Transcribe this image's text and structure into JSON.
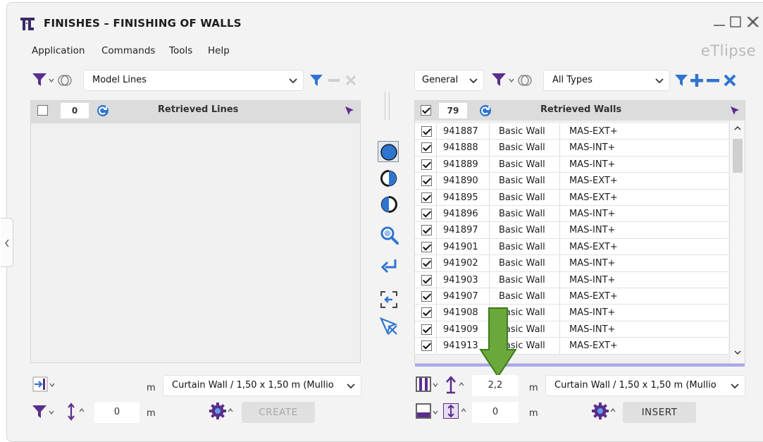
{
  "window": {
    "title": "FINISHES – FINISHING OF WALLS",
    "brand": "eTlipse"
  },
  "menu": [
    "Application",
    "Commands",
    "Tools",
    "Help"
  ],
  "left_panel": {
    "source_combo": "Model Lines",
    "count": "0",
    "header_title": "Retrieved Lines",
    "type_combo": "Curtain Wall / 1,50 x 1,50 m (Mullio",
    "unit_1": "m",
    "offset_value": "0",
    "unit_2": "m",
    "create_label": "CREATE"
  },
  "right_panel": {
    "category_combo": "General",
    "type_filter_combo": "All Types",
    "count": "79",
    "header_title": "Retrieved Walls",
    "rows": [
      {
        "id": "941887",
        "family": "Basic Wall",
        "type": "MAS-EXT+"
      },
      {
        "id": "941888",
        "family": "Basic Wall",
        "type": "MAS-INT+"
      },
      {
        "id": "941889",
        "family": "Basic Wall",
        "type": "MAS-INT+"
      },
      {
        "id": "941890",
        "family": "Basic Wall",
        "type": "MAS-EXT+"
      },
      {
        "id": "941895",
        "family": "Basic Wall",
        "type": "MAS-EXT+"
      },
      {
        "id": "941896",
        "family": "Basic Wall",
        "type": "MAS-INT+"
      },
      {
        "id": "941897",
        "family": "Basic Wall",
        "type": "MAS-INT+"
      },
      {
        "id": "941901",
        "family": "Basic Wall",
        "type": "MAS-EXT+"
      },
      {
        "id": "941902",
        "family": "Basic Wall",
        "type": "MAS-INT+"
      },
      {
        "id": "941903",
        "family": "Basic Wall",
        "type": "MAS-INT+"
      },
      {
        "id": "941907",
        "family": "Basic Wall",
        "type": "MAS-EXT+"
      },
      {
        "id": "941908",
        "family": "Basic Wall",
        "type": "MAS-INT+"
      },
      {
        "id": "941909",
        "family": "Basic Wall",
        "type": "MAS-INT+"
      },
      {
        "id": "941913",
        "family": "Basic Wall",
        "type": "MAS-EXT+"
      }
    ],
    "height_value": "2,2",
    "unit_1": "m",
    "type_combo": "Curtain Wall / 1,50 x 1,50 m (Mullio",
    "offset_value": "0",
    "unit_2": "m",
    "insert_label": "INSERT"
  },
  "colors": {
    "accent_blue": "#2f74d0",
    "accent_purple": "#6b3fb6",
    "filter_purple": "#5b2d8c",
    "arrow_green": "#6aa83c"
  }
}
